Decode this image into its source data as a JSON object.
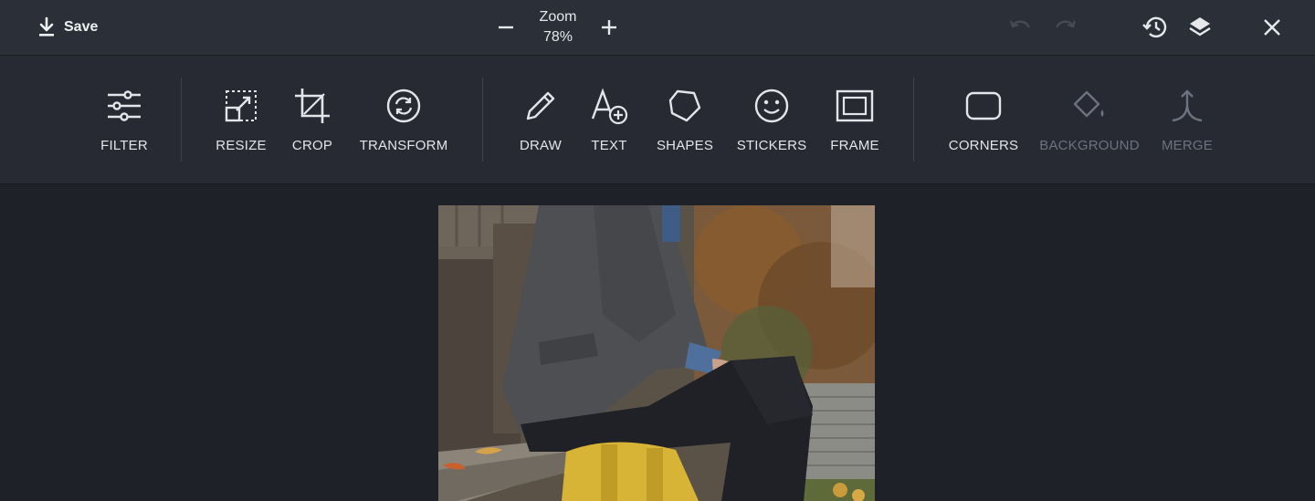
{
  "topbar": {
    "save_label": "Save",
    "zoom_label": "Zoom",
    "zoom_value": "78%"
  },
  "tools": [
    {
      "label": "FILTER",
      "icon": "sliders-icon",
      "enabled": true
    },
    {
      "label": "RESIZE",
      "icon": "resize-icon",
      "enabled": true
    },
    {
      "label": "CROP",
      "icon": "crop-icon",
      "enabled": true
    },
    {
      "label": "TRANSFORM",
      "icon": "rotate-icon",
      "enabled": true
    },
    {
      "label": "DRAW",
      "icon": "pencil-icon",
      "enabled": true
    },
    {
      "label": "TEXT",
      "icon": "text-add-icon",
      "enabled": true
    },
    {
      "label": "SHAPES",
      "icon": "polygon-icon",
      "enabled": true
    },
    {
      "label": "STICKERS",
      "icon": "smiley-icon",
      "enabled": true
    },
    {
      "label": "FRAME",
      "icon": "frame-icon",
      "enabled": true
    },
    {
      "label": "CORNERS",
      "icon": "rounded-rect-icon",
      "enabled": true
    },
    {
      "label": "BACKGROUND",
      "icon": "paint-bucket-icon",
      "enabled": false
    },
    {
      "label": "MERGE",
      "icon": "merge-icon",
      "enabled": false
    }
  ],
  "colors": {
    "topbar_bg": "#2a2f38",
    "toolbar_bg": "#272a33",
    "canvas_bg": "#1f2128",
    "text": "#e6e8ec",
    "disabled_text": "#6c7280"
  }
}
